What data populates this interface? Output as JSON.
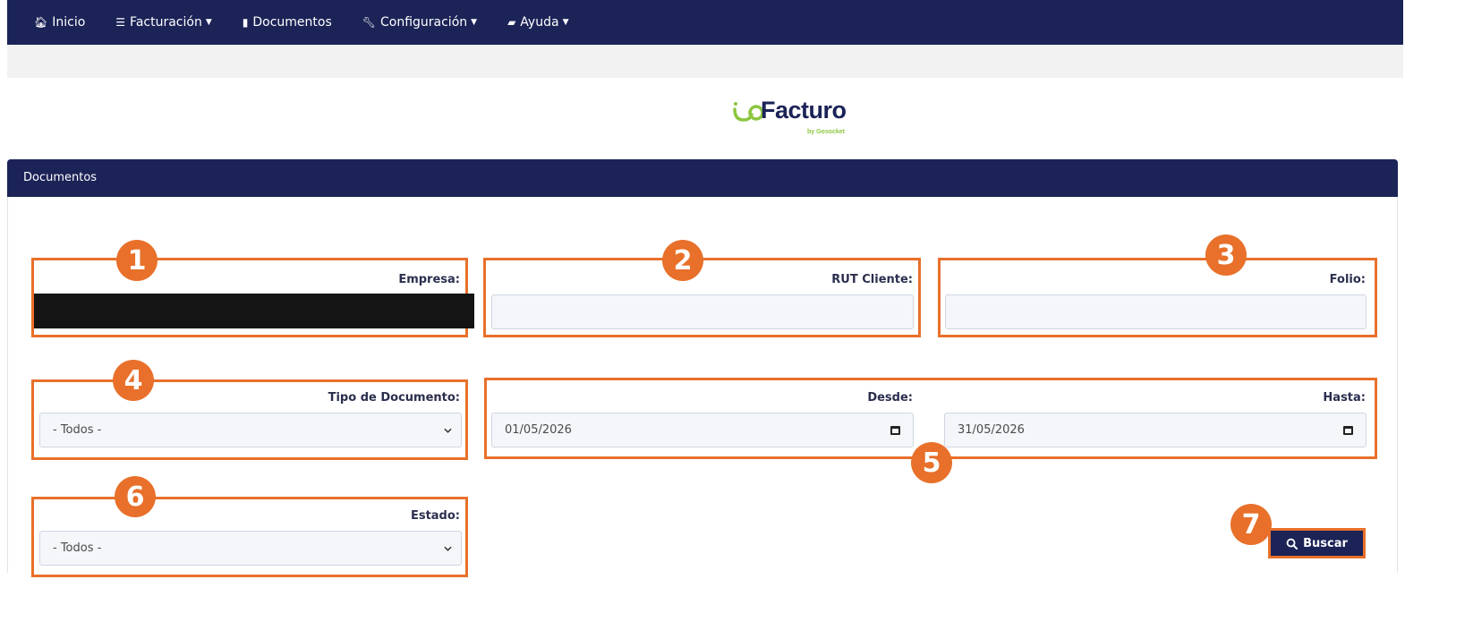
{
  "nav": {
    "items": [
      {
        "label": "Inicio",
        "icon": "home-icon"
      },
      {
        "label": "Facturación",
        "icon": "list-icon"
      },
      {
        "label": "Documentos",
        "icon": "file-icon"
      },
      {
        "label": "Configuración",
        "icon": "wrench-icon"
      },
      {
        "label": "Ayuda",
        "icon": "book-icon"
      }
    ]
  },
  "logo": {
    "name": "Facturo",
    "by": "by Gosocket"
  },
  "panel": {
    "title": "Documentos"
  },
  "form": {
    "empresa_label": "Empresa:",
    "rut_label": "RUT Cliente:",
    "rut_value": "",
    "folio_label": "Folio:",
    "folio_value": "",
    "tipo_label": "Tipo de Documento:",
    "tipo_value": "- Todos -",
    "desde_label": "Desde:",
    "desde_value": "01/05/2026",
    "hasta_label": "Hasta:",
    "hasta_value": "31/05/2026",
    "estado_label": "Estado:",
    "estado_value": "- Todos -",
    "buscar_label": "Buscar"
  },
  "badges": [
    "1",
    "2",
    "3",
    "4",
    "5",
    "6",
    "7"
  ],
  "colors": {
    "navy": "#1b2357",
    "highlight": "#e8702a",
    "logo_green": "#8cc63f"
  }
}
